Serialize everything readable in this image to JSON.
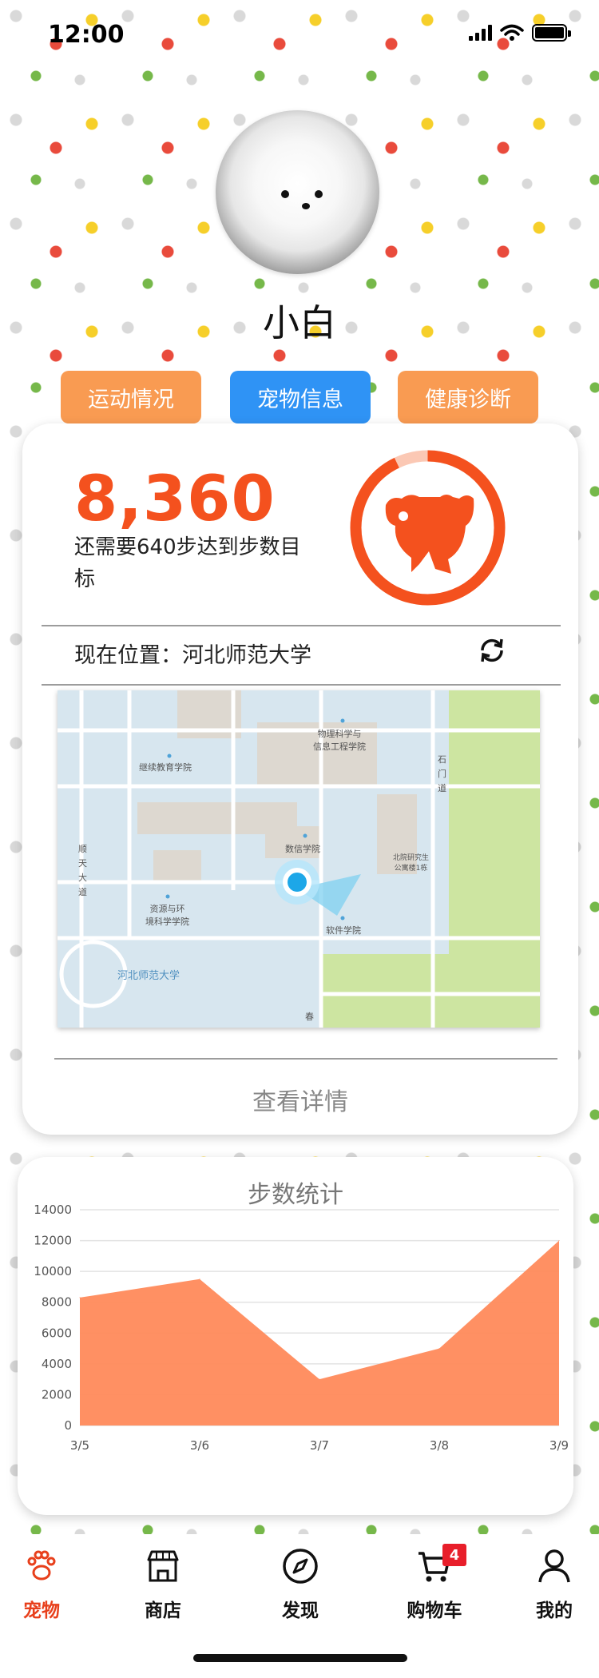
{
  "status_bar": {
    "time": "12:00"
  },
  "profile": {
    "name": "小白"
  },
  "tabs": [
    {
      "label": "运动情况"
    },
    {
      "label": "宠物信息"
    },
    {
      "label": "健康诊断"
    }
  ],
  "steps": {
    "count": "8,360",
    "remaining_text": "还需要640步达到步数目标",
    "progress_fraction": 0.9289
  },
  "location": {
    "text": "现在位置：河北师范大学",
    "map_labels": {
      "continuing_edu": "继续教育学院",
      "physics": "物理科学与\n信息工程学院",
      "math": "数信学院",
      "resources": "资源与环\n境科学学院",
      "software": "软件学院",
      "campus": "河北师范大学",
      "research": "北院研究生\n公寓楼1栋",
      "road_left": "顺\n天\n大\n道",
      "road_right": "石\n门\n道",
      "spring": "春"
    }
  },
  "detail_link": "查看详情",
  "chart_data": {
    "type": "area",
    "title": "步数统计",
    "categories": [
      "3/5",
      "3/6",
      "3/7",
      "3/8",
      "3/9"
    ],
    "values": [
      8300,
      9500,
      3000,
      5000,
      12000
    ],
    "ylim": [
      0,
      14000
    ],
    "yticks": [
      0,
      2000,
      4000,
      6000,
      8000,
      10000,
      12000,
      14000
    ],
    "color": "#ff8a5b",
    "grid": true
  },
  "tabbar": {
    "items": [
      {
        "label": "宠物",
        "icon": "paw-icon"
      },
      {
        "label": "商店",
        "icon": "store-icon"
      },
      {
        "label": "发现",
        "icon": "compass-icon"
      },
      {
        "label": "购物车",
        "icon": "cart-icon"
      },
      {
        "label": "我的",
        "icon": "user-icon"
      }
    ],
    "cart_badge": "4"
  },
  "colors": {
    "accent": "#f4511e",
    "tab_orange": "#f99b52",
    "tab_active": "#2f93f5"
  }
}
